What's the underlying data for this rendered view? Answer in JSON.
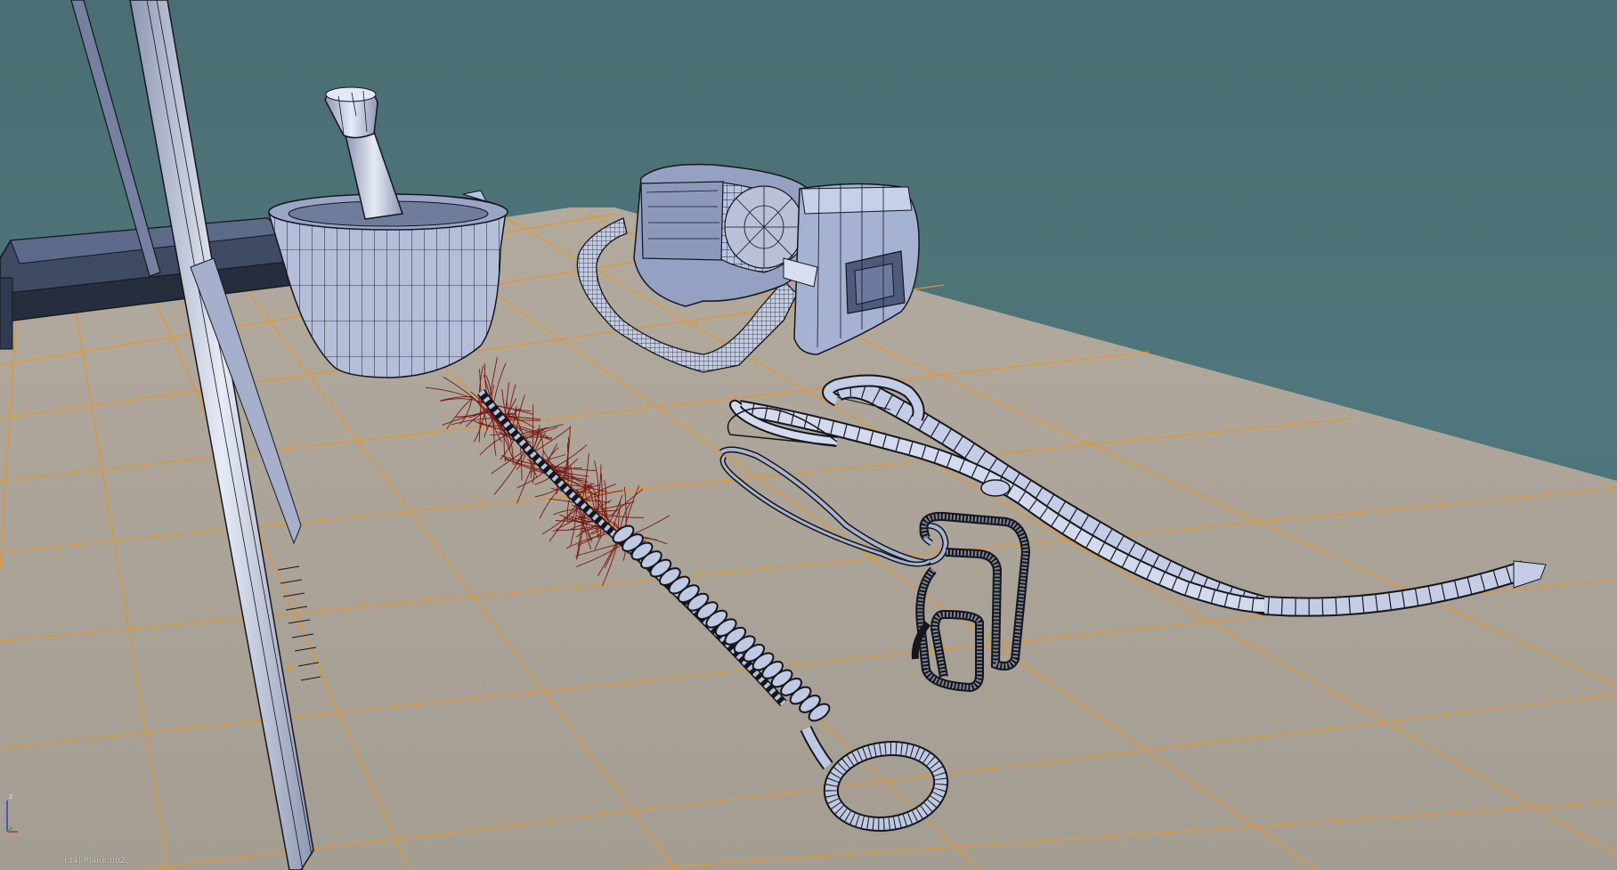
{
  "viewport": {
    "status_text": "(34) Plane.002",
    "axis_z_label": "z",
    "colors": {
      "background": "#4f767a",
      "floor": "#a8a196",
      "grid": "#e6952a",
      "mesh_fill": "#b9c4e4",
      "mesh_wire": "#1c1c22",
      "bristles": "#7a1612"
    },
    "objects": [
      {
        "name": "retort stand",
        "icon": "stand-icon"
      },
      {
        "name": "mortar and pestle",
        "icon": "mortar-icon"
      },
      {
        "name": "safety goggles",
        "icon": "goggles-icon"
      },
      {
        "name": "test tube brush",
        "icon": "brush-icon"
      },
      {
        "name": "crucible tongs",
        "icon": "tongs-icon"
      },
      {
        "name": "test tube holder",
        "icon": "holder-icon"
      }
    ]
  }
}
